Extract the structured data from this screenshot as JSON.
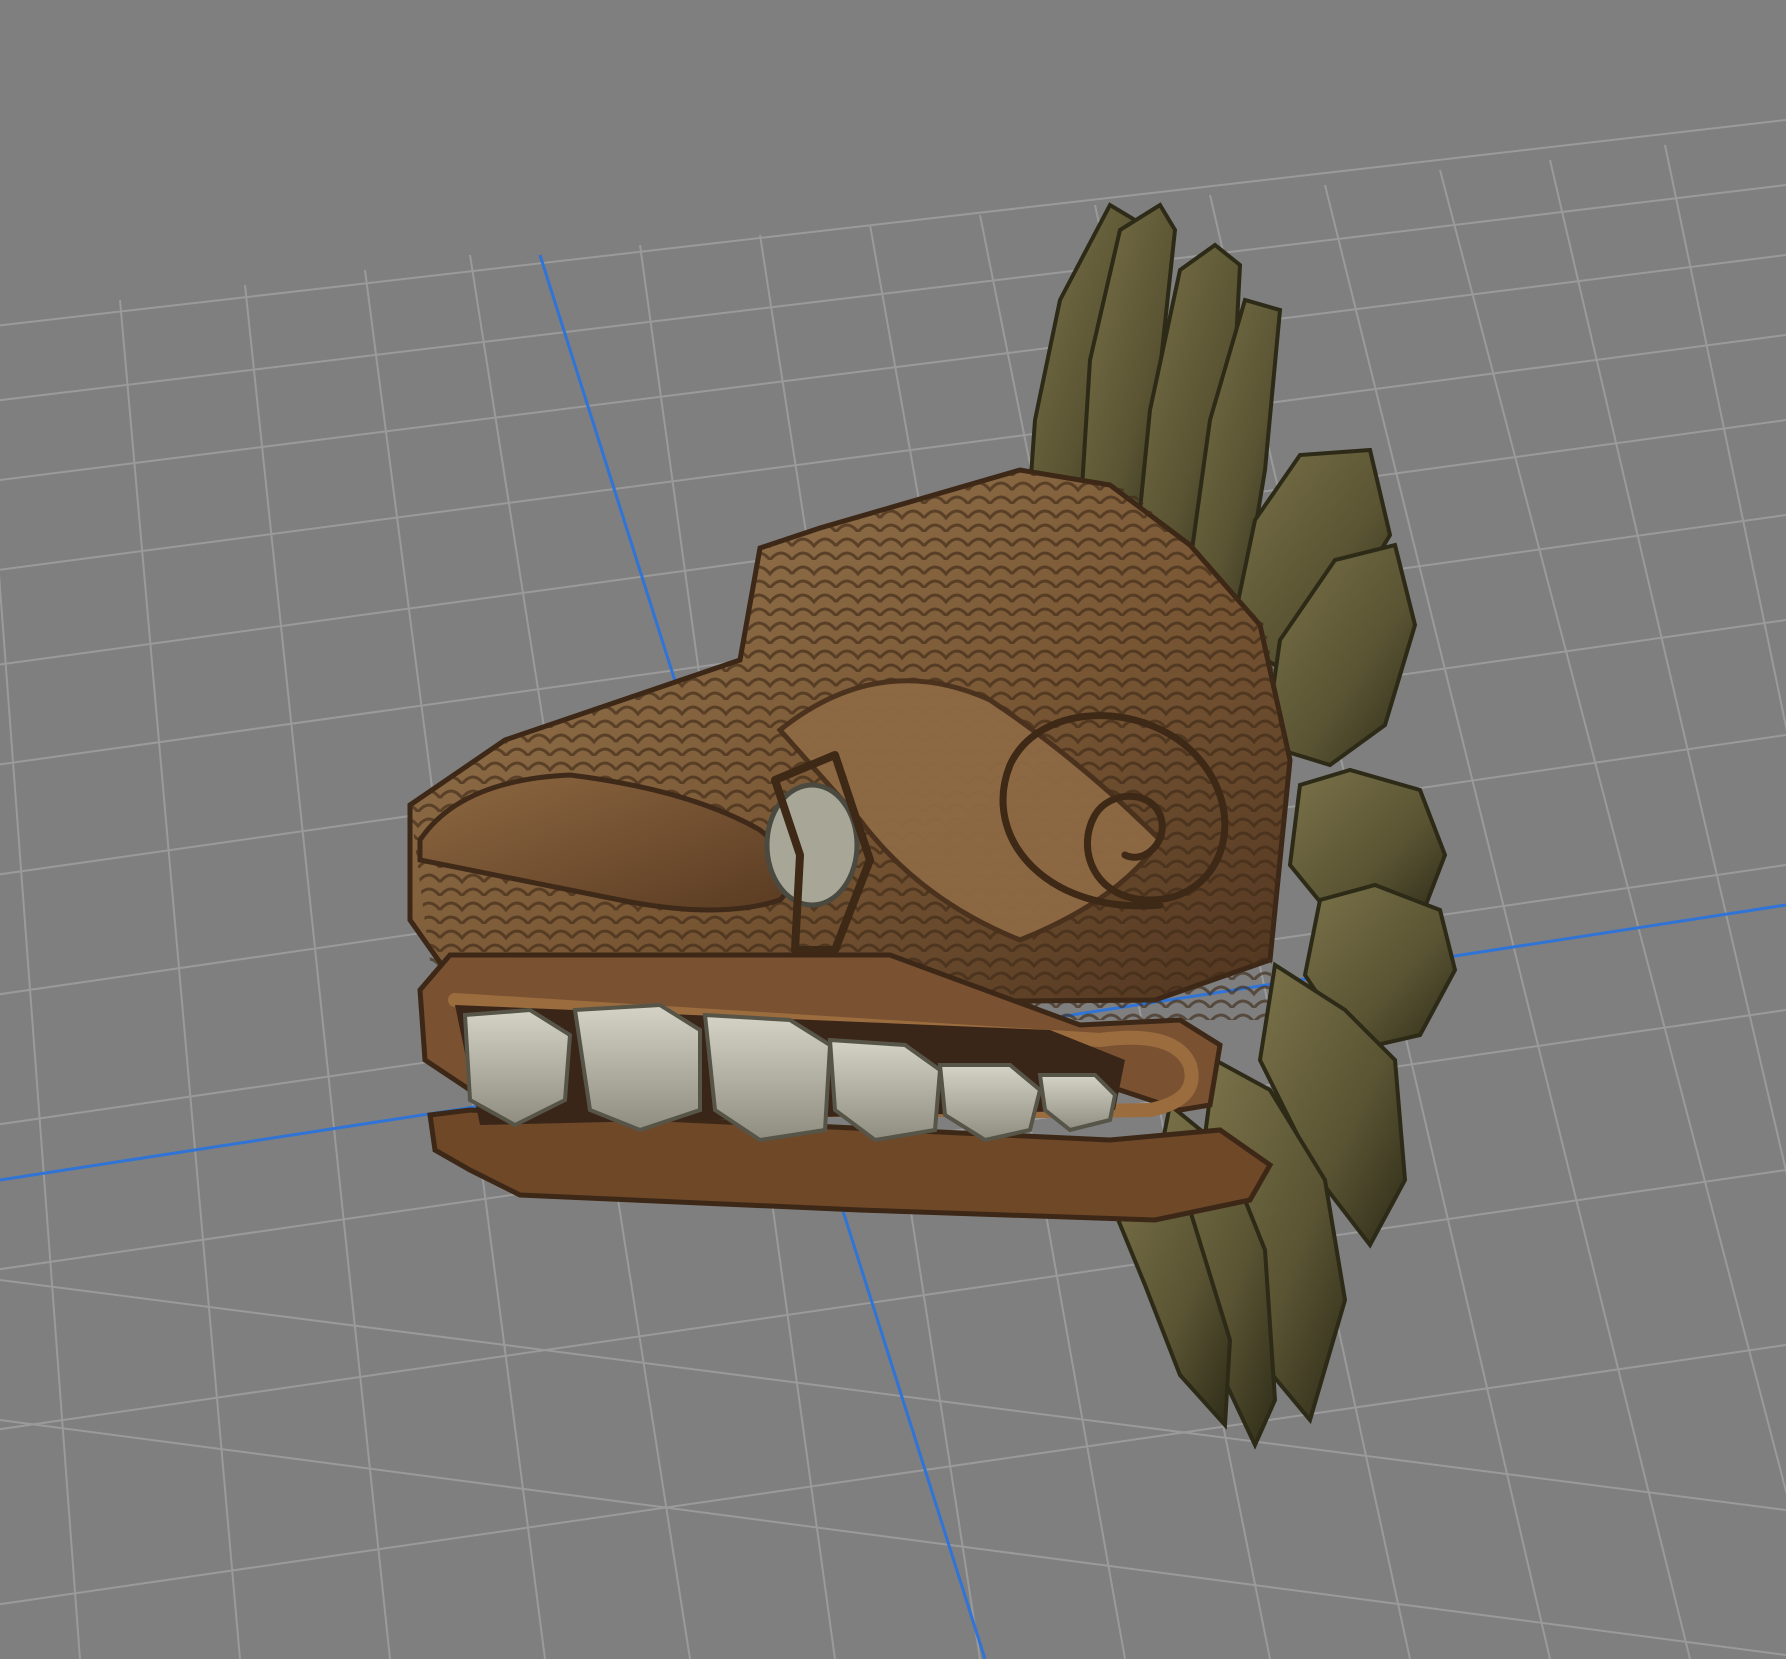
{
  "viewport": {
    "background_color": "#7f7f7f",
    "grid_line_color": "#9a9a9a",
    "axis_line_color": "#2f74d6",
    "grid_visible": true
  },
  "model": {
    "name": "serpent-head-sculpture",
    "colors": {
      "wood_light": "#8a6a44",
      "wood_mid": "#6f4f2f",
      "wood_dark": "#4b321d",
      "scales_line": "#3f2a17",
      "feather_light": "#70683f",
      "feather_mid": "#545030",
      "feather_dark": "#2e2c18",
      "teeth_light": "#c9c7b7",
      "teeth_mid": "#9f9d8f",
      "teeth_dark": "#5f5d52"
    }
  }
}
